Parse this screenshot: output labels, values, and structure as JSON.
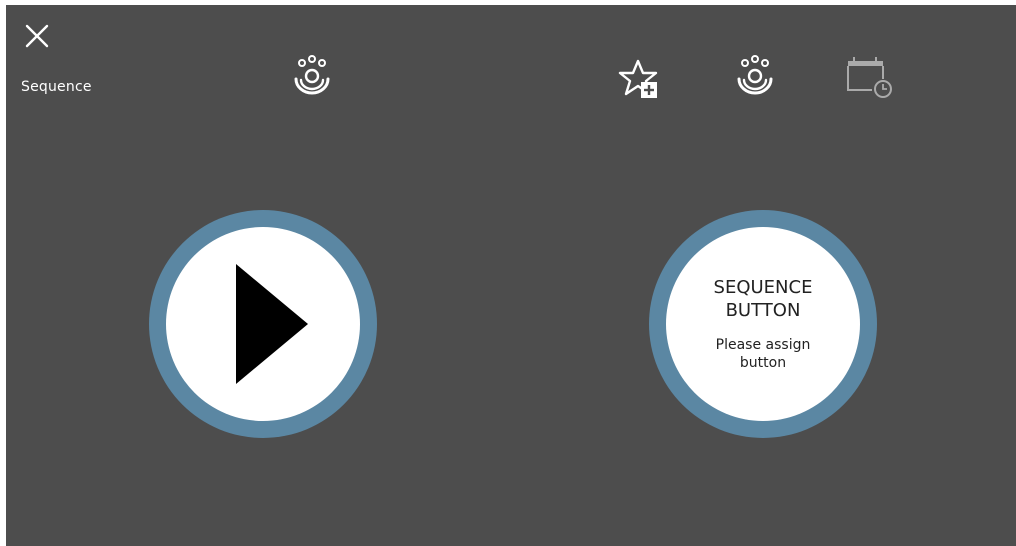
{
  "header": {
    "title": "Sequence",
    "icons": {
      "close": "close-icon",
      "sequence": "hydro-therapy-icon",
      "favorite_add": "star-plus-icon",
      "therapy": "hydro-therapy-icon",
      "schedule": "calendar-clock-icon"
    }
  },
  "main": {
    "play_icon": "play-icon",
    "sequence_button": {
      "title": "SEQUENCE BUTTON",
      "subtitle": "Please assign button"
    }
  },
  "colors": {
    "background": "#4d4d4d",
    "ring": "#5b87a3",
    "icon": "#ffffff",
    "icon_disabled": "#aaaaaa"
  }
}
